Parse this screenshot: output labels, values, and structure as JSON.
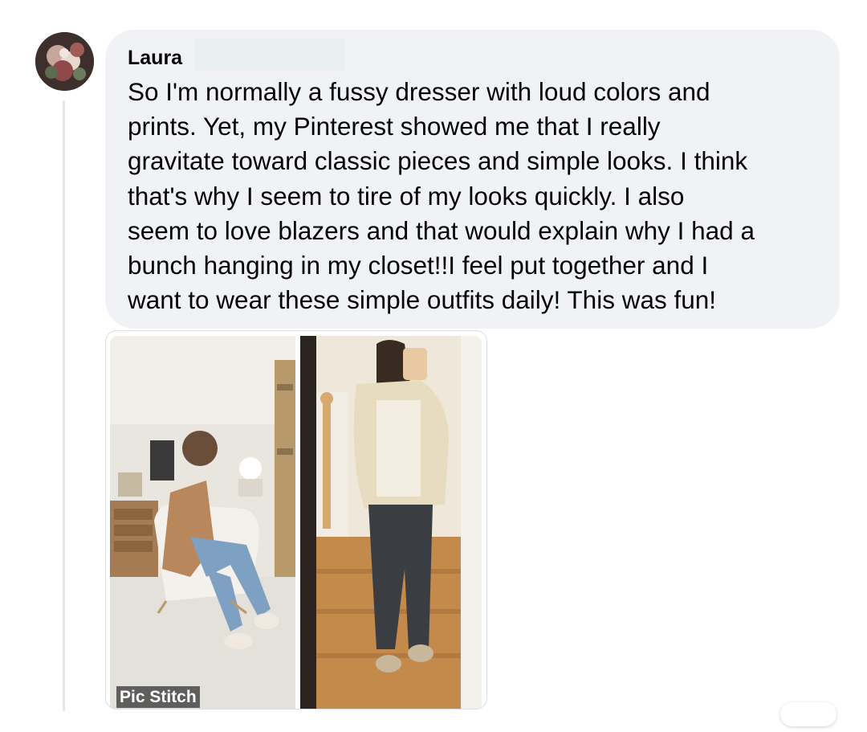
{
  "comment": {
    "author": "Laura",
    "text": "So I'm normally a fussy dresser with loud colors and\nprints. Yet, my Pinterest showed me that I really\ngravitate toward classic pieces and simple looks. I think\nthat's why I seem to tire of my looks quickly. I also\nseem to love blazers and that would explain why I had a\nbunch hanging in my closet!!I feel put together and I\nwant to wear these simple outfits daily! This was fun!"
  },
  "attachment": {
    "watermark": "Pic Stitch",
    "photos": [
      "woman-in-blazer-seated-selfie",
      "woman-in-blazer-mirror-selfie"
    ]
  },
  "colors": {
    "bubble": "#f0f2f5",
    "text": "#050505",
    "thread_line": "#e4e6eb"
  },
  "icons": [
    "avatar"
  ]
}
